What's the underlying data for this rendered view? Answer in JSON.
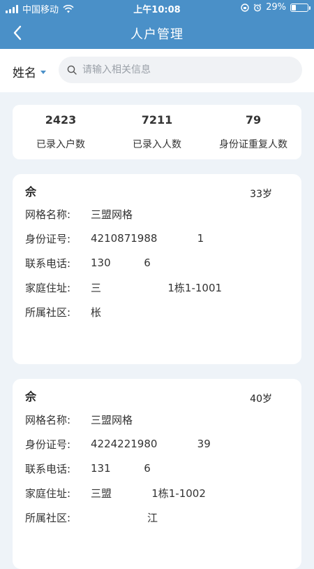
{
  "status": {
    "carrier": "中国移动",
    "time": "上午10:08",
    "battery": "29%",
    "battery_level": 0.29
  },
  "nav": {
    "title": "人户管理"
  },
  "search": {
    "filter_label": "姓名",
    "placeholder": "请输入相关信息"
  },
  "stats": [
    {
      "value": "2423",
      "label": "已录入户数"
    },
    {
      "value": "7211",
      "label": "已录入人数"
    },
    {
      "value": "79",
      "label": "身份证重复人数"
    }
  ],
  "labels": {
    "grid": "网格名称:",
    "id": "身份证号:",
    "phone": "联系电话:",
    "address": "家庭住址:",
    "community": "所属社区:"
  },
  "records": [
    {
      "name": "佘",
      "age": "33岁",
      "grid": "三盟网格",
      "id": "4210871988            1",
      "phone": "130          6",
      "address": "三                    1栋1-1001",
      "community": "枨"
    },
    {
      "name": "佘",
      "age": "40岁",
      "grid": "三盟网格",
      "id": "4224221980            39",
      "phone": "131          6",
      "address": "三盟            1栋1-1002",
      "community": "                 江"
    }
  ]
}
